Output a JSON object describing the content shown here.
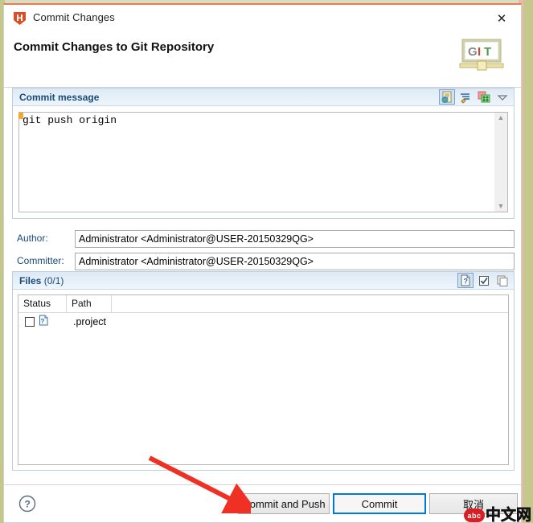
{
  "window": {
    "title": "Commit Changes",
    "icon": "h-shield-icon",
    "close_label": "✕"
  },
  "header": {
    "title": "Commit Changes to Git Repository",
    "logo_text": "GIT"
  },
  "commit_message": {
    "section_title": "Commit message",
    "value": "git push origin",
    "placeholder": "",
    "tools": [
      {
        "name": "add-signed-off-by-icon",
        "active": true
      },
      {
        "name": "add-change-id-icon",
        "active": false
      },
      {
        "name": "insert-commit-hash-icon",
        "active": false
      },
      {
        "name": "chevron-down-icon",
        "active": false
      }
    ],
    "scroll_up": "▲",
    "scroll_down": "▼"
  },
  "author": {
    "label": "Author:",
    "value": "Administrator <Administrator@USER-20150329QG>"
  },
  "committer": {
    "label": "Committer:",
    "value": "Administrator <Administrator@USER-20150329QG>"
  },
  "files": {
    "section_title": "Files",
    "count_label": "(0/1)",
    "tools": [
      {
        "name": "show-untracked-files-icon",
        "active": true
      },
      {
        "name": "select-all-icon",
        "active": false
      },
      {
        "name": "deselect-all-icon",
        "active": false
      }
    ],
    "columns": [
      "Status",
      "Path"
    ],
    "rows": [
      {
        "checked": false,
        "status_icon": "untracked-file-icon",
        "path": ".project"
      }
    ]
  },
  "footer": {
    "help_label": "?",
    "buttons": [
      {
        "id": "commit-and-push",
        "label": "Commit and Push",
        "focused": false
      },
      {
        "id": "commit",
        "label": "Commit",
        "focused": true
      },
      {
        "id": "cancel",
        "label": "取消",
        "focused": false
      }
    ]
  },
  "annotation": {
    "arrow_color": "#ee3124",
    "target": "commit-and-push-button"
  },
  "watermark": {
    "badge": "abc",
    "text": "中文网"
  },
  "colors": {
    "accent_blue": "#0078d7",
    "section_title": "#1a4a7a",
    "section_border": "#c0cfe0",
    "titlebar_accent": "#e57c52"
  }
}
